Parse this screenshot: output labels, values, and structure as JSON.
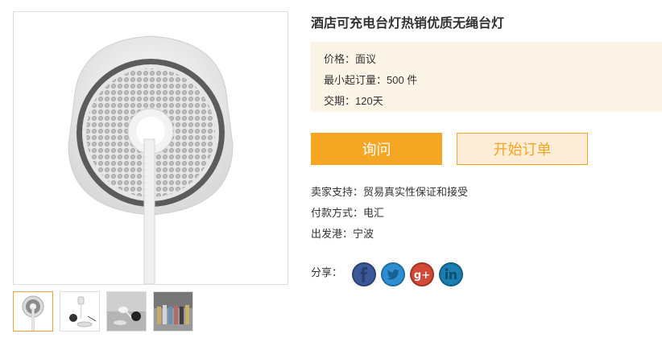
{
  "product": {
    "title": "酒店可充电台灯热销优质无绳台灯",
    "info": {
      "price": "价格：面议",
      "moq": "最小起订量：500 件",
      "delivery": "交期：120天"
    },
    "buttons": {
      "inquiry": "询问",
      "order": "开始订单"
    },
    "meta": {
      "support": "卖家支持：贸易真实性保证和接受",
      "payment": "付款方式：电汇",
      "port": "出发港：宁波"
    },
    "share_label": "分享：",
    "share_icons": [
      "facebook-icon",
      "twitter-icon",
      "google-plus-icon",
      "linkedin-icon"
    ]
  },
  "colors": {
    "accent": "#f5a623",
    "info_bg": "#fdf4e8",
    "order_bg": "#fdecd6",
    "facebook": "#3b5998",
    "twitter": "#2c8fd3",
    "google_plus": "#d34836",
    "linkedin": "#1a7fb0"
  }
}
